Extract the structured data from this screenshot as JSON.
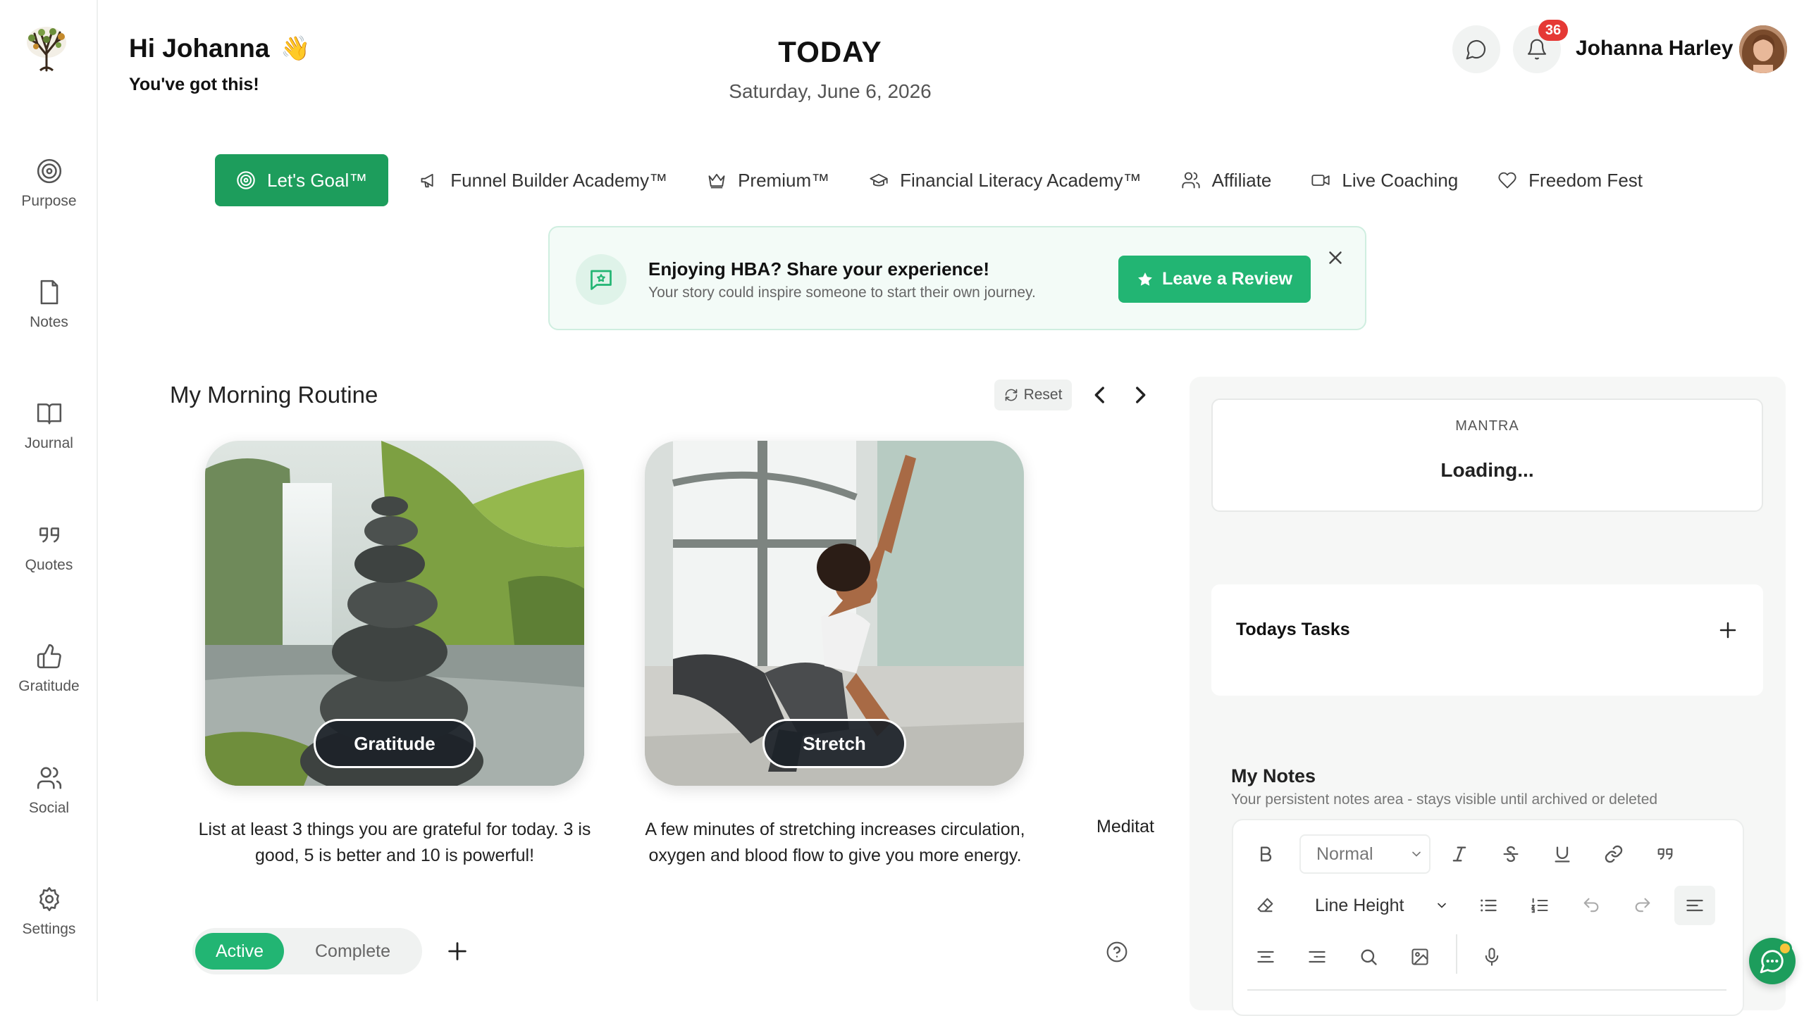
{
  "sidebar": {
    "items": [
      {
        "label": "Purpose",
        "icon": "target-icon"
      },
      {
        "label": "Notes",
        "icon": "file-icon"
      },
      {
        "label": "Journal",
        "icon": "book-icon"
      },
      {
        "label": "Quotes",
        "icon": "quote-icon"
      },
      {
        "label": "Gratitude",
        "icon": "thumbs-up-icon"
      },
      {
        "label": "Social",
        "icon": "users-icon"
      },
      {
        "label": "Settings",
        "icon": "gear-icon"
      }
    ]
  },
  "header": {
    "greeting": "Hi Johanna",
    "wave_emoji": "👋",
    "subgreeting": "You've got this!",
    "title": "TODAY",
    "date": "Saturday, June 6, 2026",
    "notification_count": "36",
    "user_name": "Johanna Harley"
  },
  "nav": {
    "tabs": [
      {
        "label": "Let's Goal™",
        "icon": "target-icon",
        "active": true
      },
      {
        "label": "Funnel Builder Academy™",
        "icon": "megaphone-icon"
      },
      {
        "label": "Premium™",
        "icon": "crown-icon"
      },
      {
        "label": "Financial Literacy Academy™",
        "icon": "graduation-cap-icon"
      },
      {
        "label": "Affiliate",
        "icon": "users-icon"
      },
      {
        "label": "Live Coaching",
        "icon": "video-icon"
      },
      {
        "label": "Freedom Fest",
        "icon": "heart-icon"
      }
    ]
  },
  "banner": {
    "title": "Enjoying HBA? Share your experience!",
    "subtitle": "Your story could inspire someone to start their own journey.",
    "button_label": "Leave a Review"
  },
  "routine": {
    "title": "My Morning Routine",
    "reset_label": "Reset",
    "cards": [
      {
        "label": "Gratitude",
        "description": "List at least 3 things you are grateful for today. 3 is good, 5 is better and 10 is powerful!"
      },
      {
        "label": "Stretch",
        "description": "A few minutes of stretching increases circulation, oxygen and blood flow to give you more energy."
      },
      {
        "label": "Meditat"
      }
    ],
    "filter": {
      "active_label": "Active",
      "complete_label": "Complete"
    }
  },
  "mantra": {
    "label": "MANTRA",
    "value": "Loading..."
  },
  "tasks": {
    "title": "Todays Tasks"
  },
  "notes": {
    "title": "My Notes",
    "subtitle": "Your persistent notes area - stays visible until archived or deleted",
    "editor": {
      "format_select": "Normal",
      "line_height_select": "Line Height"
    }
  },
  "colors": {
    "accent": "#22b573",
    "accent_dark": "#1d9d5c",
    "badge": "#e53935",
    "banner_bg": "#f3fbf7"
  }
}
